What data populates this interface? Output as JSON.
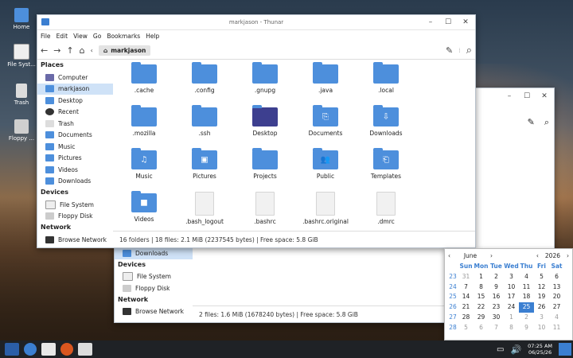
{
  "desktop": {
    "icons": [
      {
        "label": "Home"
      },
      {
        "label": "File Syst..."
      },
      {
        "label": "Trash"
      },
      {
        "label": "Floppy ..."
      }
    ]
  },
  "front": {
    "title": "markjason - Thunar",
    "menu": [
      "File",
      "Edit",
      "View",
      "Go",
      "Bookmarks",
      "Help"
    ],
    "path": "markjason",
    "places_header": "Places",
    "places": [
      "Computer",
      "markjason",
      "Desktop",
      "Recent",
      "Trash",
      "Documents",
      "Music",
      "Pictures",
      "Videos",
      "Downloads"
    ],
    "devices_header": "Devices",
    "devices": [
      "File System",
      "Floppy Disk"
    ],
    "network_header": "Network",
    "network": [
      "Browse Network"
    ],
    "files": [
      {
        "name": ".cache",
        "kind": "folder",
        "emblem": ""
      },
      {
        "name": ".config",
        "kind": "folder",
        "emblem": ""
      },
      {
        "name": ".gnupg",
        "kind": "folder",
        "emblem": ""
      },
      {
        "name": ".java",
        "kind": "folder",
        "emblem": ""
      },
      {
        "name": ".local",
        "kind": "folder",
        "emblem": ""
      },
      {
        "name": ".mozilla",
        "kind": "folder",
        "emblem": ""
      },
      {
        "name": ".ssh",
        "kind": "folder",
        "emblem": ""
      },
      {
        "name": "Desktop",
        "kind": "desktop",
        "emblem": ""
      },
      {
        "name": "Documents",
        "kind": "folder",
        "emblem": "⎘"
      },
      {
        "name": "Downloads",
        "kind": "folder",
        "emblem": "⇩"
      },
      {
        "name": "Music",
        "kind": "folder",
        "emblem": "♫"
      },
      {
        "name": "Pictures",
        "kind": "folder",
        "emblem": "▣"
      },
      {
        "name": "Projects",
        "kind": "folder",
        "emblem": ""
      },
      {
        "name": "Public",
        "kind": "folder",
        "emblem": "👥"
      },
      {
        "name": "Templates",
        "kind": "folder",
        "emblem": "⎗"
      },
      {
        "name": "Videos",
        "kind": "folder",
        "emblem": "■"
      },
      {
        "name": ".bash_logout",
        "kind": "doc",
        "emblem": ""
      },
      {
        "name": ".bashrc",
        "kind": "doc",
        "emblem": ""
      },
      {
        "name": ".bashrc.original",
        "kind": "doc",
        "emblem": ""
      },
      {
        "name": ".dmrc",
        "kind": "doc",
        "emblem": ""
      }
    ],
    "status": "16 folders  |  18 files: 2.1 MiB (2237545 bytes)  |  Free space: 5.8 GiB"
  },
  "back": {
    "downloads": "Downloads",
    "devices_header": "Devices",
    "devices": [
      "File System",
      "Floppy Disk"
    ],
    "network_header": "Network",
    "network": [
      "Browse Network"
    ],
    "status": "2 files: 1.6 MiB (1678240 bytes)  |  Free space: 5.8 GiB"
  },
  "calendar": {
    "month": "June",
    "year": "2026",
    "days": [
      "Sun",
      "Mon",
      "Tue",
      "Wed",
      "Thu",
      "Fri",
      "Sat"
    ],
    "weeks": [
      {
        "wk": "23",
        "d": [
          "31",
          "1",
          "2",
          "3",
          "4",
          "5",
          "6"
        ]
      },
      {
        "wk": "24",
        "d": [
          "7",
          "8",
          "9",
          "10",
          "11",
          "12",
          "13"
        ]
      },
      {
        "wk": "25",
        "d": [
          "14",
          "15",
          "16",
          "17",
          "18",
          "19",
          "20"
        ]
      },
      {
        "wk": "26",
        "d": [
          "21",
          "22",
          "23",
          "24",
          "25",
          "26",
          "27"
        ]
      },
      {
        "wk": "27",
        "d": [
          "28",
          "29",
          "30",
          "1",
          "2",
          "3",
          "4"
        ]
      },
      {
        "wk": "28",
        "d": [
          "5",
          "6",
          "7",
          "8",
          "9",
          "10",
          "11"
        ]
      }
    ],
    "today": "25"
  },
  "taskbar": {
    "time": "07:25 AM",
    "date": "06/25/26"
  },
  "colors": {
    "accent": "#3b7fd1",
    "folder": "#4d8fdc"
  }
}
